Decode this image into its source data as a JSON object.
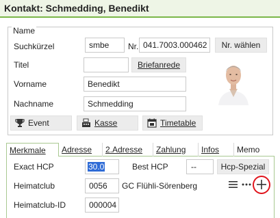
{
  "window": {
    "title": "Kontakt: Schmedding, Benedikt"
  },
  "name_group": {
    "legend": "Name",
    "suchkuerzel": {
      "label": "Suchkürzel",
      "value": "smbe"
    },
    "nr": {
      "label": "Nr.",
      "value": "041.7003.000462"
    },
    "nr_waehlen_label": "Nr. wählen",
    "titel": {
      "label": "Titel",
      "value": ""
    },
    "briefanrede_label": "Briefanrede",
    "vorname": {
      "label": "Vorname",
      "value": "Benedikt"
    },
    "nachname": {
      "label": "Nachname",
      "value": "Schmedding"
    }
  },
  "actions": {
    "event_label": "Event",
    "kasse_label": "Kasse",
    "timetable_label": "Timetable"
  },
  "tabs": [
    {
      "label": "Merkmale",
      "active": true
    },
    {
      "label": "Adresse",
      "active": false
    },
    {
      "label": "2.Adresse",
      "active": false
    },
    {
      "label": "Zahlung",
      "active": false
    },
    {
      "label": "Infos",
      "active": false
    },
    {
      "label": "Memo",
      "active": false
    }
  ],
  "merkmale": {
    "exact_hcp": {
      "label": "Exact HCP",
      "value": "30.0"
    },
    "best_hcp": {
      "label": "Best HCP",
      "value": "--"
    },
    "hcp_spezial_label": "Hcp-Spezial",
    "heimatclub": {
      "label": "Heimatclub",
      "code": "0056",
      "name": "GC Flühli-Sörenberg"
    },
    "heimatclub_id": {
      "label": "Heimatclub-ID",
      "value": "000004"
    }
  },
  "colors": {
    "accent_green": "#7ab648",
    "highlight_ring": "#e0141c",
    "selection": "#2e6bd6"
  },
  "icons": [
    "trophy-icon",
    "cash-register-icon",
    "calendar-icon",
    "list-icon",
    "more-icon",
    "plus-icon"
  ]
}
